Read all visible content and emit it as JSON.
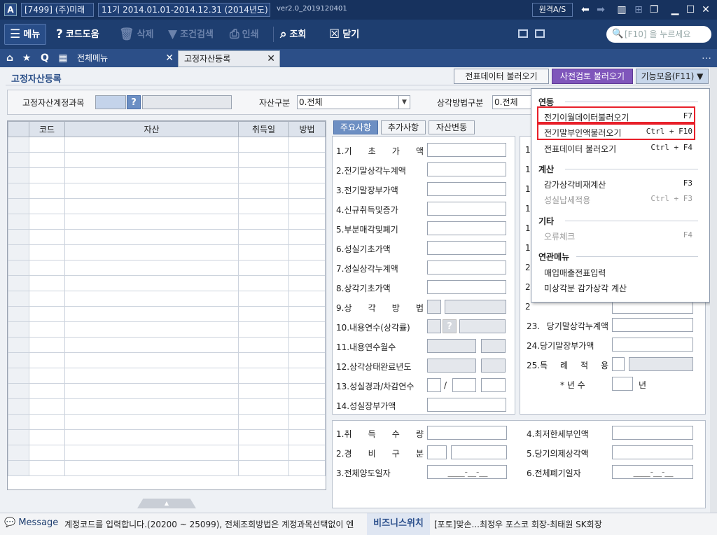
{
  "titlebar": {
    "logo": "A",
    "company": "[7499] (주)미래",
    "period": "11기 2014.01.01-2014.12.31 (2014년도)",
    "version": "ver2.0_2019120401",
    "remote": "원격A/S"
  },
  "toolbar": {
    "menu": "메뉴",
    "help": "코드도움",
    "delete": "삭제",
    "filter": "조건검색",
    "print": "인쇄",
    "view": "조회",
    "close": "닫기",
    "search_placeholder": "[F10] 을 누르세요"
  },
  "tabs": {
    "t1": "전체메뉴",
    "t2": "고정자산등록"
  },
  "page": {
    "title": "고정자산등록",
    "btn_voucher": "전표데이터 불러오기",
    "btn_precheck": "사전검토 불러오기",
    "btn_functions": "기능모음(F11)"
  },
  "filters": {
    "account_label": "고정자산계정과목",
    "asset_type_label": "자산구분",
    "asset_type_value": "0.전체",
    "dep_method_label": "상각방법구분",
    "dep_method_value": "0.전체"
  },
  "grid": {
    "headers": [
      "코드",
      "자산",
      "취득일",
      "방법"
    ]
  },
  "panel_tabs": [
    "주요사항",
    "추가사항",
    "자산변동"
  ],
  "main_fields_left": [
    "1.기 초 가 액",
    "2.전기말상각누계액",
    "3.전기말장부가액",
    "4.신규취득및증가",
    "5.부분매각및폐기",
    "6.성실기초가액",
    "7.성실상각누계액",
    "8.상각기초가액",
    "9.상 각 방 법",
    "10.내용연수(상각률)",
    "11.내용연수월수",
    "12.상각상태완료년도",
    "13.성실경과/차감연수",
    "14.성실장부가액"
  ],
  "main_fields_right": [
    "23. 당기말상각누계액",
    "24.당기말장부가액",
    "25.특 례 적 용",
    "* 년 수"
  ],
  "right_partial_nums": [
    "1",
    "1",
    "1",
    "1",
    "1",
    "1",
    "2",
    "2",
    "2"
  ],
  "years_suffix": "년",
  "slash": "/",
  "bottom_left": [
    "1.취 득 수 량",
    "2.경 비 구 분",
    "3.전체양도일자"
  ],
  "bottom_right": [
    "4.최저한세부인액",
    "5.당기의제상각액",
    "6.전체폐기일자"
  ],
  "date_placeholder": "____-__-__",
  "dropdown": {
    "sec1": "연동",
    "i1": "전기이월데이터불러오기",
    "k1": "F7",
    "i2": "전기말부인액불러오기",
    "k2": "Ctrl + F10",
    "i3": "전표데이터 불러오기",
    "k3": "Ctrl + F4",
    "sec2": "계산",
    "i4": "감가상각비재계산",
    "k4": "F3",
    "i5": "성실납세적용",
    "k5": "Ctrl + F3",
    "sec3": "기타",
    "i6": "오류체크",
    "k6": "F4",
    "sec4": "연관메뉴",
    "i7": "매입매출전표입력",
    "i8": "미상각분 감가상각 계산"
  },
  "status": {
    "message_label": "Message",
    "message": "계정코드를 입력합니다.(20200 ~ 25099), 전체조회방법은 계정과목선택없이 엔",
    "biz": "비즈니스위치",
    "news": "[포토]맞손...최정우 포스코 회장-최태원 SK회장"
  },
  "colors": {
    "accent": "#1e3e70",
    "purple": "#7f56bb",
    "highlight": "#e8202a"
  }
}
